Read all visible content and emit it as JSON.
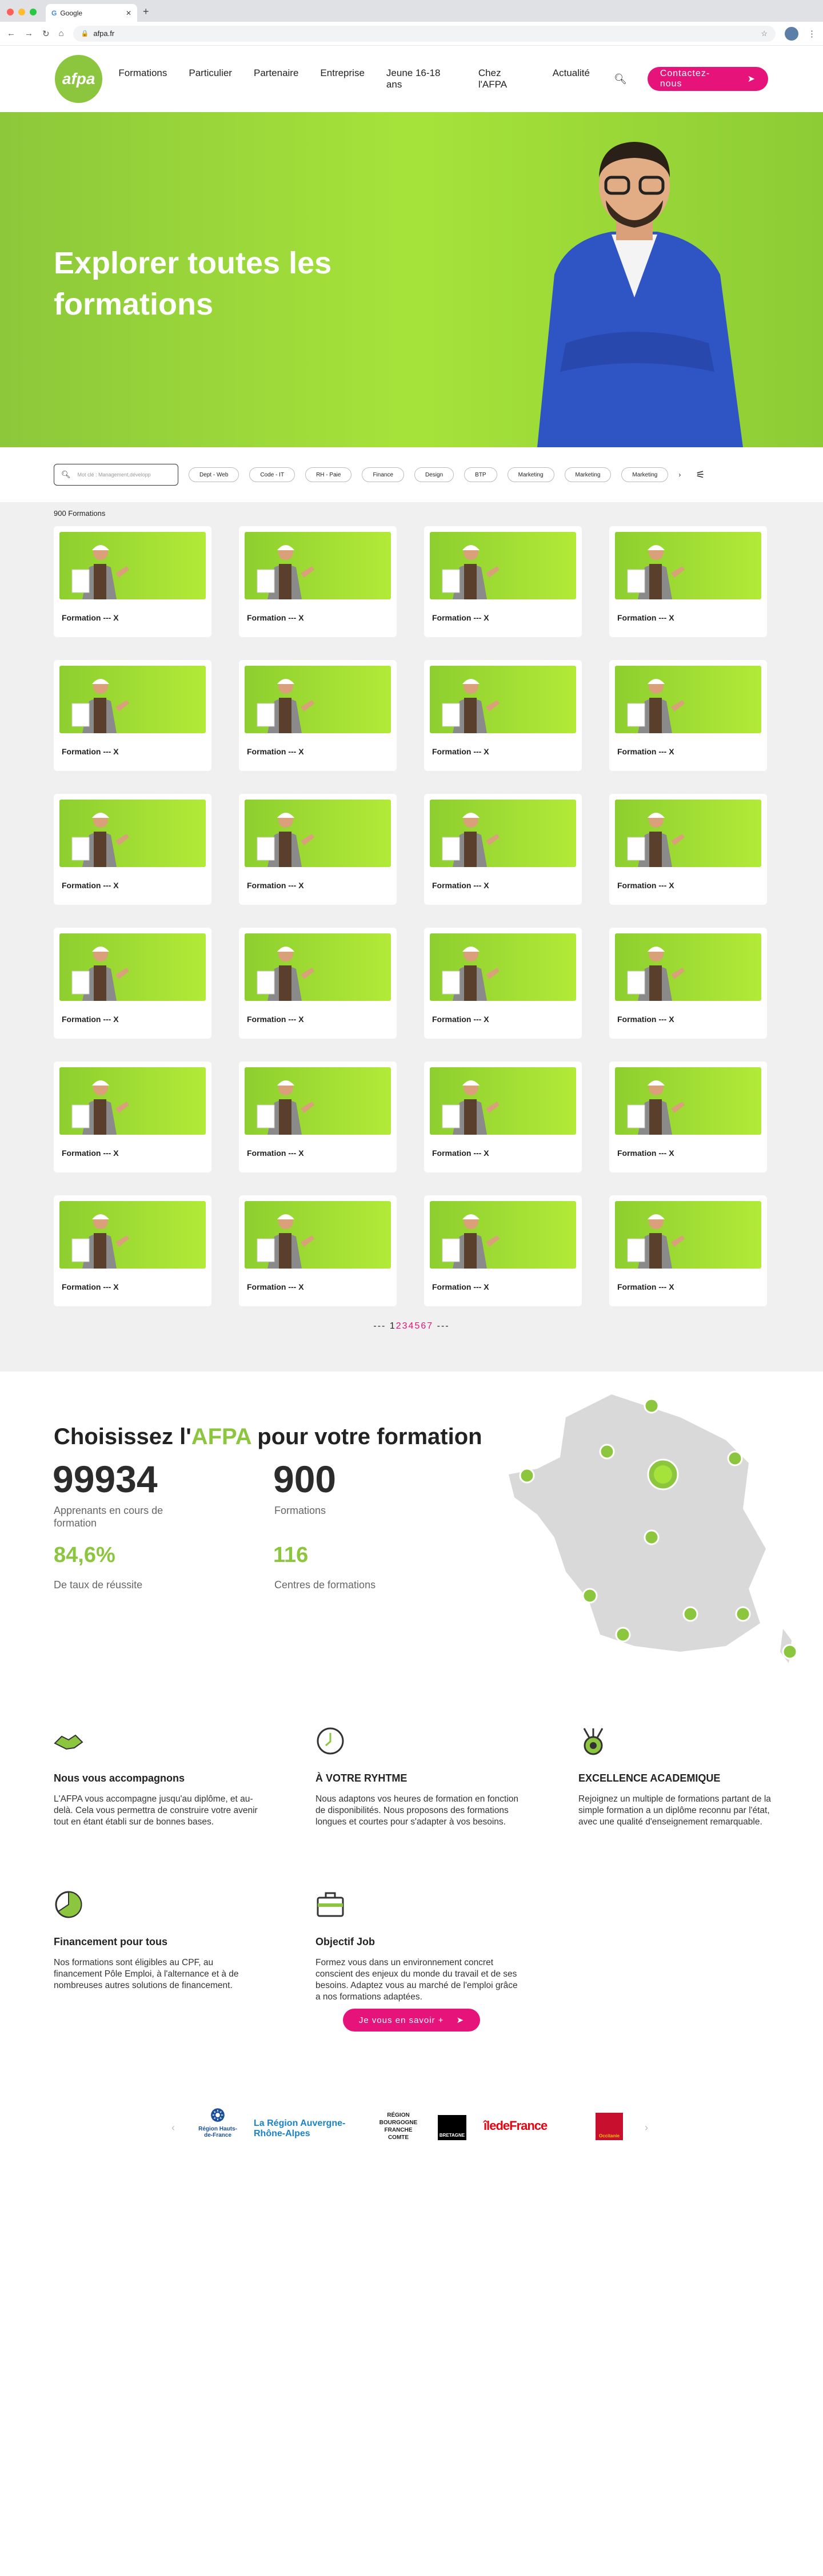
{
  "browser": {
    "tab_title": "Google",
    "url": "afpa.fr"
  },
  "header": {
    "logo_text": "afpa",
    "nav": [
      "Formations",
      "Particulier",
      "Partenaire",
      "Entreprise",
      "Jeune 16-18 ans",
      "Chez l'AFPA",
      "Actualité"
    ],
    "cta_label": "Contactez-nous"
  },
  "hero": {
    "title_line1": "Explorer toutes les",
    "title_line2": "formations"
  },
  "filters": {
    "search_placeholder": "Mot clé : Management,développ",
    "chips": [
      "Dept - Web",
      "Code - IT",
      "RH - Paie",
      "Finance",
      "Design",
      "BTP",
      "Marketing",
      "Marketing",
      "Marketing"
    ]
  },
  "catalog": {
    "count_label": "900 Formations",
    "card_title": "Formation --- X",
    "cards": 24,
    "pagination": {
      "prev": "---",
      "current": "1",
      "pages": [
        "2",
        "3",
        "4",
        "5",
        "6",
        "7"
      ],
      "next": "---"
    }
  },
  "stats": {
    "title_prefix": "Choisissez l'",
    "title_accent": "AFPA",
    "title_suffix": " pour votre formation",
    "learners_value": "99934",
    "learners_label": "Apprenants en cours de formation",
    "formations_value": "900",
    "formations_label": "Formations",
    "success_value": "84,6%",
    "success_label": "De taux de réussite",
    "centers_value": "116",
    "centers_label": "Centres de formations"
  },
  "features": [
    {
      "icon": "handshake-icon",
      "title": "Nous vous accompagnons",
      "text": "L'AFPA vous accompagne jusqu'au diplôme, et au-delà. Cela vous permettra de construire votre avenir tout en étant établi sur de bonnes bases."
    },
    {
      "icon": "clock-icon",
      "title": "À VOTRE RYHTME",
      "text": "Nous adaptons vos heures de formation en fonction de disponibilités. Nous proposons des formations longues et courtes pour s'adapter à vos besoins."
    },
    {
      "icon": "medal-icon",
      "title": "EXCELLENCE ACADEMIQUE",
      "text": "Rejoignez un multiple de formations partant de la simple formation a un diplôme reconnu par l'état, avec une qualité d'enseignement remarquable."
    },
    {
      "icon": "pie-chart-icon",
      "title": "Financement pour tous",
      "text": "Nos formations sont éligibles au CPF, au financement Pôle Emploi, à l'alternance et à de nombreuses autres solutions de financement."
    },
    {
      "icon": "briefcase-icon",
      "title": "Objectif Job",
      "text": "Formez vous dans un environnement concret conscient des enjeux du monde du travail et de ses besoins. Adaptez vous au marché de l'emploi grâce a nos formations adaptées."
    }
  ],
  "more_button": "Je vous en savoir +",
  "partners": [
    "Région Hauts-de-France",
    "La Région Auvergne-Rhône-Alpes",
    "RÉGION BOURGOGNE FRANCHE COMTE",
    "BRETAGNE",
    "îledeFrance",
    "Occitanie"
  ],
  "colors": {
    "green": "#8cc63f",
    "pink": "#e6147a"
  }
}
